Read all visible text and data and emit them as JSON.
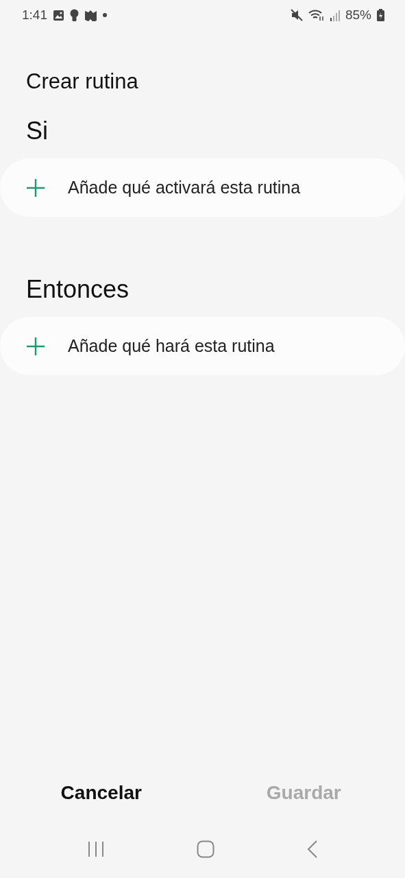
{
  "status_bar": {
    "time": "1:41",
    "battery": "85%"
  },
  "title": "Crear rutina",
  "sections": [
    {
      "heading": "Si",
      "action": "Añade qué activará esta rutina"
    },
    {
      "heading": "Entonces",
      "action": "Añade qué hará esta rutina"
    }
  ],
  "buttons": [
    {
      "label": "Cancelar",
      "disabled": false
    },
    {
      "label": "Guardar",
      "disabled": true
    }
  ]
}
